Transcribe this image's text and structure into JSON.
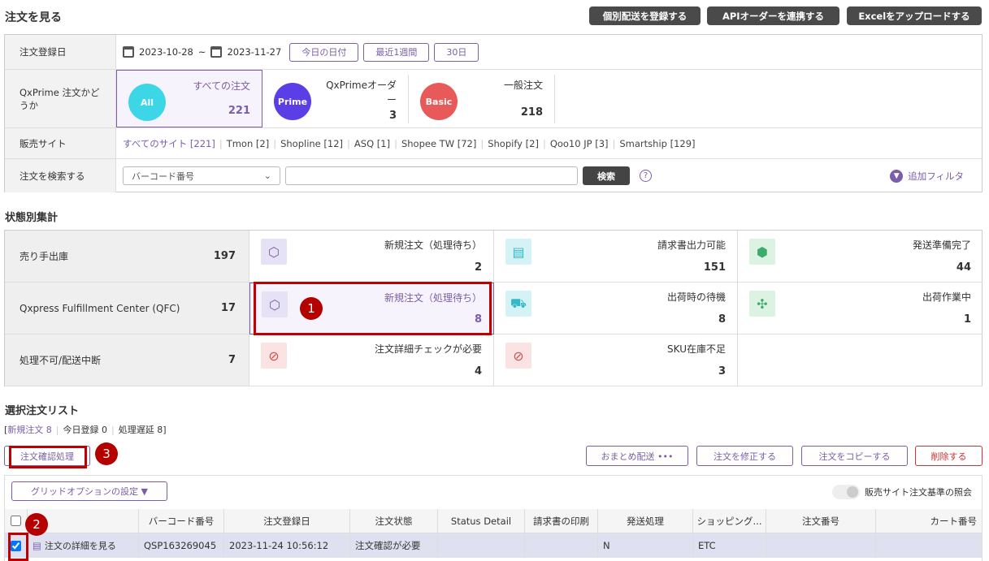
{
  "page_title": "注文を見る",
  "header_buttons": [
    "個別配送を登録する",
    "APIオーダーを連携する",
    "Excelをアップロードする"
  ],
  "filters": {
    "date": {
      "label": "注文登録日",
      "from": "2023-10-28",
      "sep": "~",
      "to": "2023-11-27",
      "buttons": [
        "今日の日付",
        "最近1週間",
        "30日"
      ]
    },
    "prime": {
      "label": "QxPrime 注文かどうか",
      "types": [
        {
          "badge": "All",
          "name": "すべての注文",
          "count": "221",
          "color": "#3dd6e6",
          "selected": true
        },
        {
          "badge": "Prime",
          "name": "QxPrimeオーダー",
          "count": "3",
          "color": "#5b3ee6"
        },
        {
          "badge": "Basic",
          "name": "一般注文",
          "count": "218",
          "color": "#e85a5a"
        }
      ]
    },
    "sites": {
      "label": "販売サイト",
      "items": [
        "すべてのサイト [221]",
        "Tmon [2]",
        "Shopline [12]",
        "ASQ [1]",
        "Shopee TW [72]",
        "Shopify [2]",
        "Qoo10 JP [3]",
        "Smartship [129]"
      ]
    },
    "search": {
      "label": "注文を検索する",
      "select_value": "バーコード番号",
      "input_value": "",
      "button": "検索",
      "add_filter": "追加フィルタ"
    }
  },
  "status_title": "状態別集計",
  "status_rows": [
    {
      "label": "売り手出庫",
      "count": "197",
      "cells": [
        {
          "title": "新規注文（処理待ち）",
          "count": "2",
          "icon": "box-icon",
          "tone": "purple"
        },
        {
          "title": "請求書出力可能",
          "count": "151",
          "icon": "invoice-icon",
          "tone": "cyan"
        },
        {
          "title": "発送準備完了",
          "count": "44",
          "icon": "box-check-icon",
          "tone": "green"
        }
      ]
    },
    {
      "label": "Qxpress Fulfillment Center (QFC)",
      "count": "17",
      "cells": [
        {
          "title": "新規注文（処理待ち）",
          "count": "8",
          "icon": "box-icon",
          "tone": "purple",
          "selected": true
        },
        {
          "title": "出荷時の待機",
          "count": "8",
          "icon": "cart-icon",
          "tone": "cyan"
        },
        {
          "title": "出荷作業中",
          "count": "1",
          "icon": "puzzle-icon",
          "tone": "green"
        }
      ]
    },
    {
      "label": "処理不可/配送中断",
      "count": "7",
      "cells": [
        {
          "title": "注文詳細チェックが必要",
          "count": "4",
          "icon": "box-error-icon",
          "tone": "red"
        },
        {
          "title": "SKU在庫不足",
          "count": "3",
          "icon": "box-error-icon",
          "tone": "red"
        }
      ]
    }
  ],
  "list": {
    "title": "選択注文リスト",
    "summary": {
      "open": "[",
      "new": "新規注文 8",
      "today": "今日登録 0",
      "delay": "処理遅延 8",
      "close": "]"
    },
    "confirm_button": "注文確認処理",
    "action_buttons": [
      "おまとめ配送 •••",
      "注文を修正する",
      "注文をコピーする",
      "削除する"
    ],
    "grid_option": "グリッドオプションの設定 ▼",
    "toggle_label": "販売サイト注文基準の照会",
    "columns": [
      "",
      "バーコード番号",
      "注文登録日",
      "注文状態",
      "Status Detail",
      "請求書の印刷",
      "発送処理",
      "ショッピング...",
      "注文番号",
      "カート番号"
    ],
    "rows": [
      {
        "checked": true,
        "view": "注文の詳細を見る",
        "cells": [
          "QSP163269045",
          "2023-11-24 10:56:12",
          "注文確認が必要",
          "",
          "",
          "N",
          "ETC",
          "",
          ""
        ]
      }
    ]
  },
  "annotations": [
    "1",
    "2",
    "3"
  ],
  "colors": {
    "accent": "#7b5ea7",
    "annotation": "#c00000"
  }
}
